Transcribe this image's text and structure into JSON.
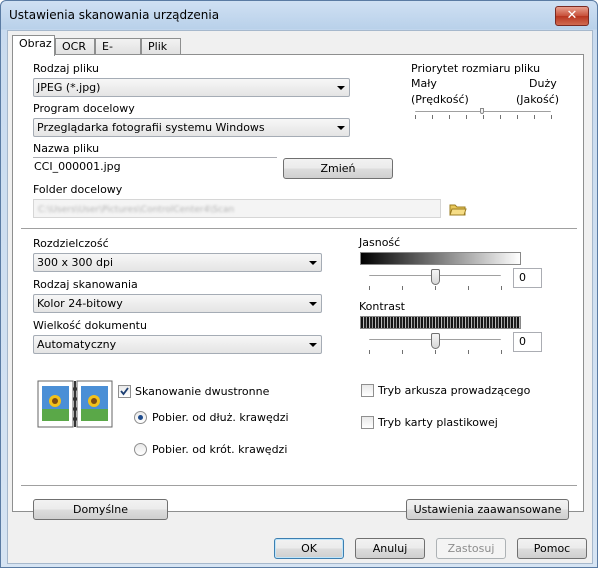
{
  "window": {
    "title": "Ustawienia skanowania urządzenia",
    "close_glyph": "✕"
  },
  "tabs": [
    {
      "label": "Obraz",
      "active": true
    },
    {
      "label": "OCR",
      "active": false
    },
    {
      "label": "E-mail",
      "active": false
    },
    {
      "label": "Plik",
      "active": false
    }
  ],
  "file_type": {
    "label": "Rodzaj pliku",
    "value": "JPEG (*.jpg)"
  },
  "target_app": {
    "label": "Program docelowy",
    "value": "Przeglądarka fotografii systemu Windows"
  },
  "file_name": {
    "label": "Nazwa pliku",
    "value": "CCI_000001.jpg",
    "change_button": "Zmień"
  },
  "dest_folder": {
    "label": "Folder docelowy",
    "value": "C:\\Users\\User\\Pictures\\ControlCenter4\\Scan",
    "folder_icon": "folder-open-icon"
  },
  "file_size_priority": {
    "title": "Priorytet rozmiaru pliku",
    "low": "Mały",
    "high": "Duży",
    "low_sub": "(Prędkość)",
    "high_sub": "(Jakość)",
    "level": 0.5
  },
  "resolution": {
    "label": "Rozdzielczość",
    "value": "300 x 300 dpi"
  },
  "scan_type": {
    "label": "Rodzaj skanowania",
    "value": "Kolor 24-bitowy"
  },
  "doc_size": {
    "label": "Wielkość dokumentu",
    "value": "Automatyczny"
  },
  "brightness": {
    "label": "Jasność",
    "value": "0",
    "level": 0.5
  },
  "contrast": {
    "label": "Kontrast",
    "value": "0",
    "level": 0.5
  },
  "duplex": {
    "label": "Skanowanie dwustronne",
    "checked": true,
    "long_edge": "Pobier. od dłuż. krawędzi",
    "short_edge": "Pobier. od krót. krawędzi",
    "selected": "long_edge",
    "icon": "duplex-book-icon"
  },
  "carrier_sheet": {
    "label": "Tryb arkusza prowadzącego",
    "checked": false
  },
  "plastic_card": {
    "label": "Tryb karty plastikowej",
    "checked": false
  },
  "buttons": {
    "defaults": "Domyślne",
    "advanced": "Ustawienia zaawansowane",
    "ok": "OK",
    "cancel": "Anuluj",
    "apply": "Zastosuj",
    "help": "Pomoc"
  }
}
